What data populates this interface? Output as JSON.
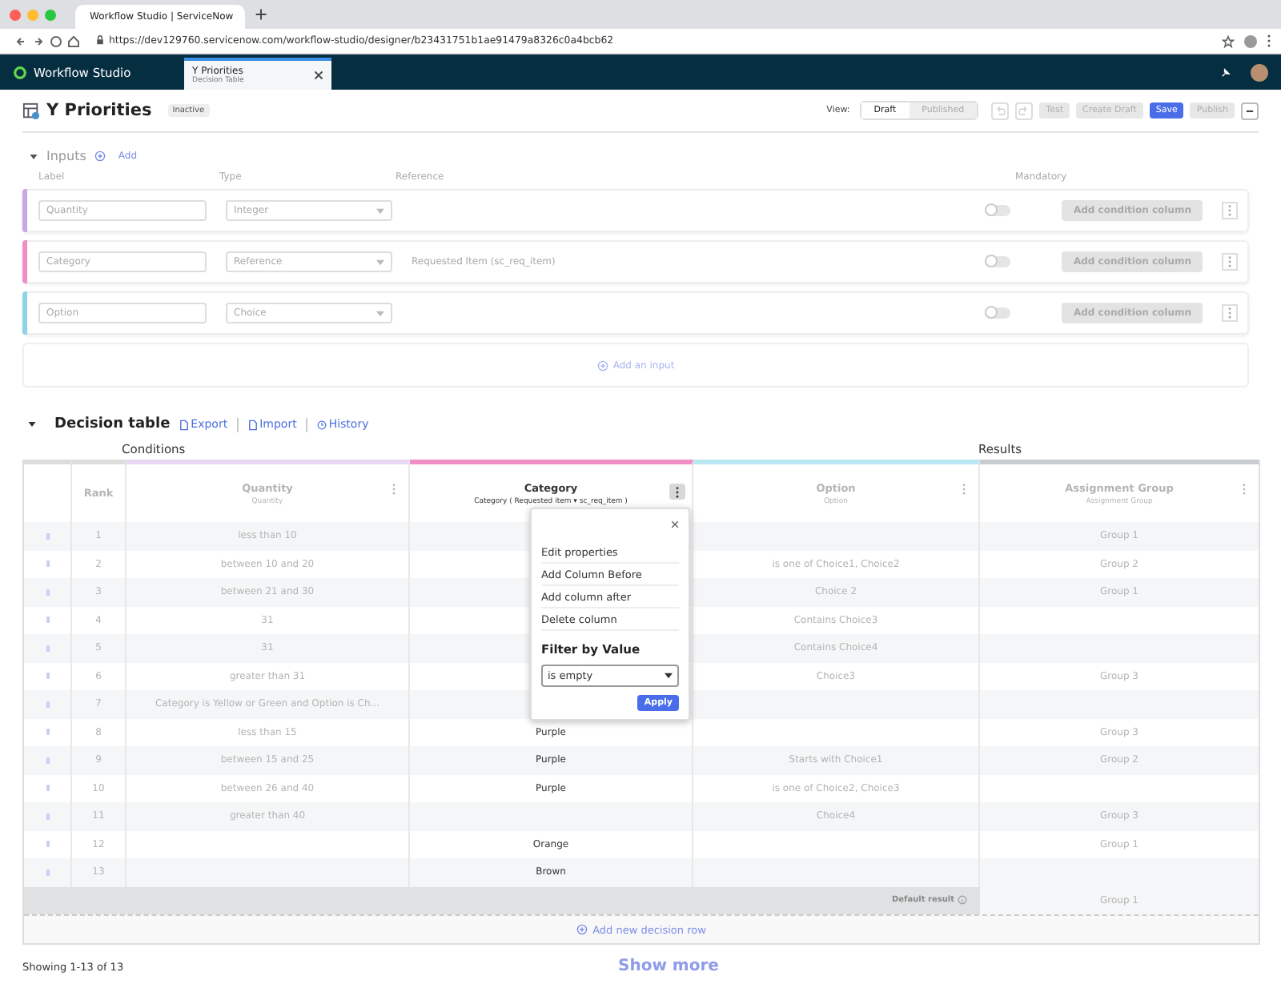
{
  "browser": {
    "tab_title": "Workflow Studio | ServiceNow",
    "url": "https://dev129760.servicenow.com/workflow-studio/designer/b23431751b1ae91479a8326c0a4bcb62"
  },
  "app_bar": {
    "title": "Workflow Studio",
    "tab": {
      "title": "Y Priorities",
      "subtitle": "Decision Table"
    }
  },
  "header": {
    "title": "Y Priorities",
    "status": "Inactive",
    "view_label": "View:",
    "views": [
      {
        "label": "Draft",
        "selected": true
      },
      {
        "label": "Published",
        "selected": false
      }
    ],
    "buttons": [
      {
        "kind": "undo",
        "disabled": true
      },
      {
        "kind": "redo",
        "disabled": true
      },
      {
        "kind": "text",
        "label": "Test",
        "disabled": true,
        "primary": false
      },
      {
        "kind": "text",
        "label": "Create Draft",
        "disabled": true,
        "primary": false
      },
      {
        "kind": "text",
        "label": "Save",
        "disabled": false,
        "primary": true
      },
      {
        "kind": "text",
        "label": "Publish",
        "disabled": true,
        "primary": false
      },
      {
        "kind": "more",
        "disabled": false
      }
    ]
  },
  "inputs": {
    "title": "Inputs",
    "add_label": "Add",
    "columns": [
      "Label",
      "Type",
      "Reference",
      "Mandatory"
    ],
    "rows": [
      {
        "label": "Quantity",
        "type": "Integer",
        "reference": "",
        "mandatory": false,
        "color": "#c9a6e8",
        "action": "Add condition column"
      },
      {
        "label": "Category",
        "type": "Reference",
        "reference": "Requested Item (sc_req_item)",
        "mandatory": false,
        "color": "#ef8fc4",
        "action": "Add condition column"
      },
      {
        "label": "Option",
        "type": "Choice",
        "reference": "",
        "mandatory": false,
        "color": "#8fd3e6",
        "action": "Add condition column"
      }
    ],
    "add_input": "Add an input"
  },
  "decision_table": {
    "title": "Decision table",
    "links": [
      {
        "label": "Export",
        "kind": "doc"
      },
      {
        "label": "Import",
        "kind": "doc"
      },
      {
        "label": "History",
        "kind": "clock"
      }
    ],
    "groups": [
      "Conditions",
      "Results"
    ],
    "columns": [
      {
        "title": "Rank",
        "color": "#dddddd",
        "focused": false
      },
      {
        "title": "Quantity",
        "subtitle": "Quantity",
        "color": "#e8d6f5",
        "focused": false
      },
      {
        "title": "Category",
        "subtitle": "Category ( Requested item ▾ sc_req_item )",
        "color": "#ef8fc4",
        "focused": true
      },
      {
        "title": "Option",
        "subtitle": "Option",
        "color": "#b9e6f0",
        "focused": false
      },
      {
        "title": "Assignment Group",
        "subtitle": "Assignment Group",
        "color": "#c8ccd0",
        "focused": false
      }
    ],
    "rows": [
      [
        "1",
        "less than 10",
        "",
        "",
        "Group 1"
      ],
      [
        "2",
        "between 10 and 20",
        "",
        "is one of Choice1, Choice2",
        "Group 2"
      ],
      [
        "3",
        "between 21 and 30",
        "",
        "Choice 2",
        "Group 1"
      ],
      [
        "4",
        "31",
        "",
        "Contains Choice3",
        ""
      ],
      [
        "5",
        "31",
        "",
        "Contains Choice4",
        ""
      ],
      [
        "6",
        "greater than 31",
        "",
        "Choice3",
        "Group 3"
      ],
      [
        "7",
        "Category is Yellow or Green and Option is Ch...",
        "",
        "",
        ""
      ],
      [
        "8",
        "less than 15",
        "Purple",
        "",
        "Group 3"
      ],
      [
        "9",
        "between 15 and 25",
        "Purple",
        "Starts with Choice1",
        "Group 2"
      ],
      [
        "10",
        "between 26 and 40",
        "Purple",
        "is one of Choice2, Choice3",
        ""
      ],
      [
        "11",
        "greater than 40",
        "",
        "Choice4",
        "Group 3"
      ],
      [
        "12",
        "",
        "Orange",
        "",
        "Group 1"
      ],
      [
        "13",
        "",
        "Brown",
        "",
        ""
      ]
    ],
    "default_label": "Default result",
    "default_value": "Group 1",
    "add_row": "Add new decision row"
  },
  "column_menu": {
    "items": [
      "Edit properties",
      "Add Column Before",
      "Add column after",
      "Delete column"
    ],
    "filter_title": "Filter by Value",
    "filter_value": "is empty",
    "apply": "Apply"
  },
  "footer": {
    "showing": "Showing 1-13 of 13",
    "show_more": "Show more"
  }
}
